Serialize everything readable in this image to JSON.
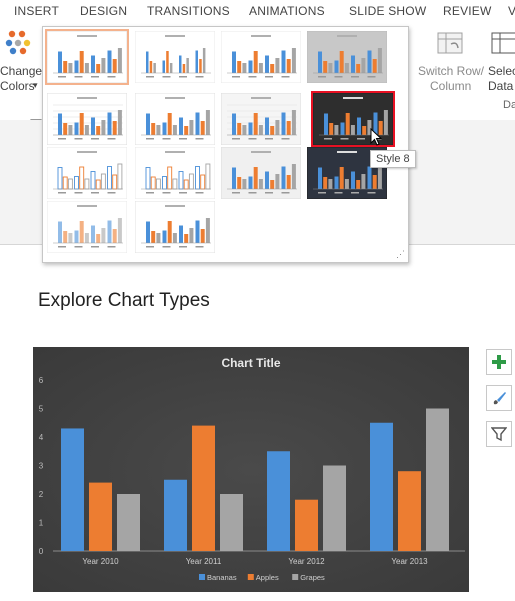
{
  "tabs": [
    "INSERT",
    "DESIGN",
    "TRANSITIONS",
    "ANIMATIONS",
    "SLIDE SHOW",
    "REVIEW",
    "V"
  ],
  "ribbon": {
    "change_colors_line1": "Change",
    "change_colors_line2": "Colors",
    "dropdown_caret": "▾",
    "switch_row_line1": "Switch Row/",
    "switch_row_line2": "Column",
    "select_data_line1": "Selec",
    "select_data_line2": "Data",
    "data_group_label": "Da"
  },
  "tooltip": "Style 8",
  "gallery": {
    "selected_index": 0,
    "hovered_index": 7,
    "resize_grip": "⋰"
  },
  "slide_title": "Explore Chart Types",
  "chart_data": {
    "type": "bar",
    "title": "Chart Title",
    "categories": [
      "Year 2010",
      "Year 2011",
      "Year 2012",
      "Year 2013"
    ],
    "series": [
      {
        "name": "Bananas",
        "values": [
          4.3,
          2.5,
          3.5,
          4.5
        ],
        "color": "#4a90d9"
      },
      {
        "name": "Apples",
        "values": [
          2.4,
          4.4,
          1.8,
          2.8
        ],
        "color": "#ed7d31"
      },
      {
        "name": "Grapes",
        "values": [
          2.0,
          2.0,
          3.0,
          5.0
        ],
        "color": "#a5a5a5"
      }
    ],
    "y_ticks": [
      "0",
      "1",
      "2",
      "3",
      "4",
      "5",
      "6"
    ],
    "ylim": [
      0,
      6
    ],
    "grid": false,
    "legend": "bottom",
    "background": "#3a3a3a"
  },
  "colors": {
    "selection_outline": "#f4b28d",
    "hover_outline": "#e81123",
    "plus_icon": "#2e9b47",
    "filter_icon": "#555555"
  }
}
